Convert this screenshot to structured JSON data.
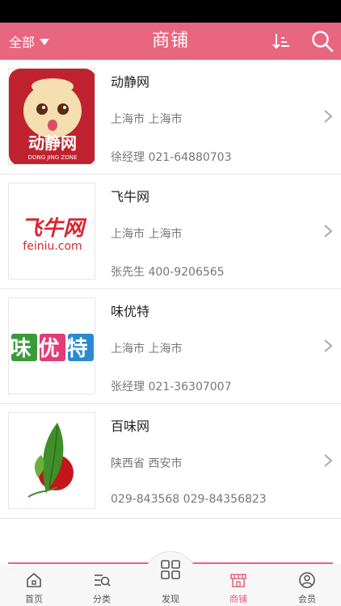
{
  "header": {
    "filter_label": "全部",
    "title": "商铺"
  },
  "shops": [
    {
      "name": "动静网",
      "location": "上海市 上海市",
      "contact": "徐经理 021-64880703",
      "logo_text": "动静网",
      "logo_subtext": "DONG JING ZONE"
    },
    {
      "name": "飞牛网",
      "location": "上海市 上海市",
      "contact": "张先生 400-9206565",
      "logo_text": "飞牛网",
      "logo_subtext": "feiniu.com"
    },
    {
      "name": "味优特",
      "location": "上海市 上海市",
      "contact": "张经理 021-36307007",
      "logo_text": "味优特",
      "logo_subtext": ""
    },
    {
      "name": "百味网",
      "location": "陕西省 西安市",
      "contact": "029-843568 029-84356823",
      "logo_text": "",
      "logo_subtext": ""
    }
  ],
  "tabs": [
    {
      "label": "首页",
      "icon": "home-icon"
    },
    {
      "label": "分类",
      "icon": "category-search-icon"
    },
    {
      "label": "发现",
      "icon": "grid-icon"
    },
    {
      "label": "商铺",
      "icon": "shop-icon"
    },
    {
      "label": "会员",
      "icon": "user-icon"
    }
  ],
  "colors": {
    "accent": "#e8667f",
    "text": "#222222",
    "muted": "#777777"
  }
}
